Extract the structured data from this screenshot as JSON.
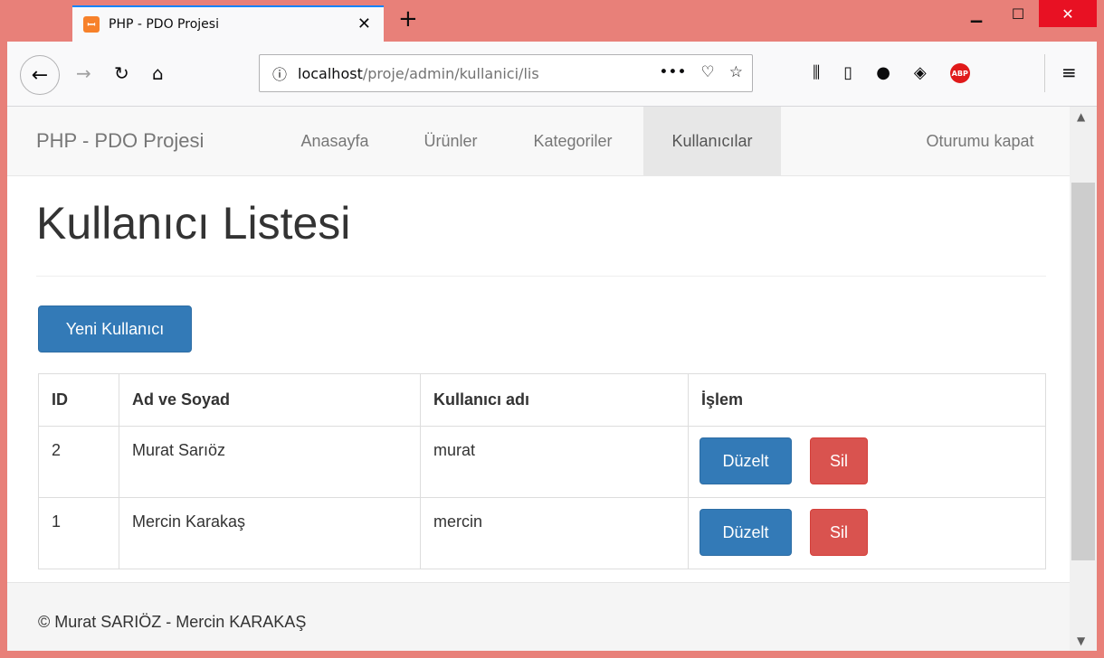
{
  "browser": {
    "tab_title": "PHP - PDO Projesi",
    "favicon": "xampp-icon",
    "url_host": "localhost",
    "url_path": "/proje/admin/kullanici/lis",
    "accent": "#e88079"
  },
  "navbar": {
    "brand": "PHP - PDO Projesi",
    "items": [
      {
        "label": "Anasayfa"
      },
      {
        "label": "Ürünler"
      },
      {
        "label": "Kategoriler"
      },
      {
        "label": "Kullanıcılar",
        "active": true
      }
    ],
    "logout": "Oturumu kapat"
  },
  "page": {
    "title": "Kullanıcı Listesi",
    "new_button": "Yeni Kullanıcı"
  },
  "table": {
    "headers": [
      "ID",
      "Ad ve Soyad",
      "Kullanıcı adı",
      "İşlem"
    ],
    "rows": [
      {
        "id": "2",
        "name": "Murat Sarıöz",
        "username": "murat",
        "edit": "Düzelt",
        "delete": "Sil"
      },
      {
        "id": "1",
        "name": "Mercin Karakaş",
        "username": "mercin",
        "edit": "Düzelt",
        "delete": "Sil"
      }
    ]
  },
  "footer": {
    "text": "© Murat SARIÖZ - Mercin KARAKAŞ"
  },
  "colors": {
    "primary": "#337ab7",
    "danger": "#d9534f"
  }
}
